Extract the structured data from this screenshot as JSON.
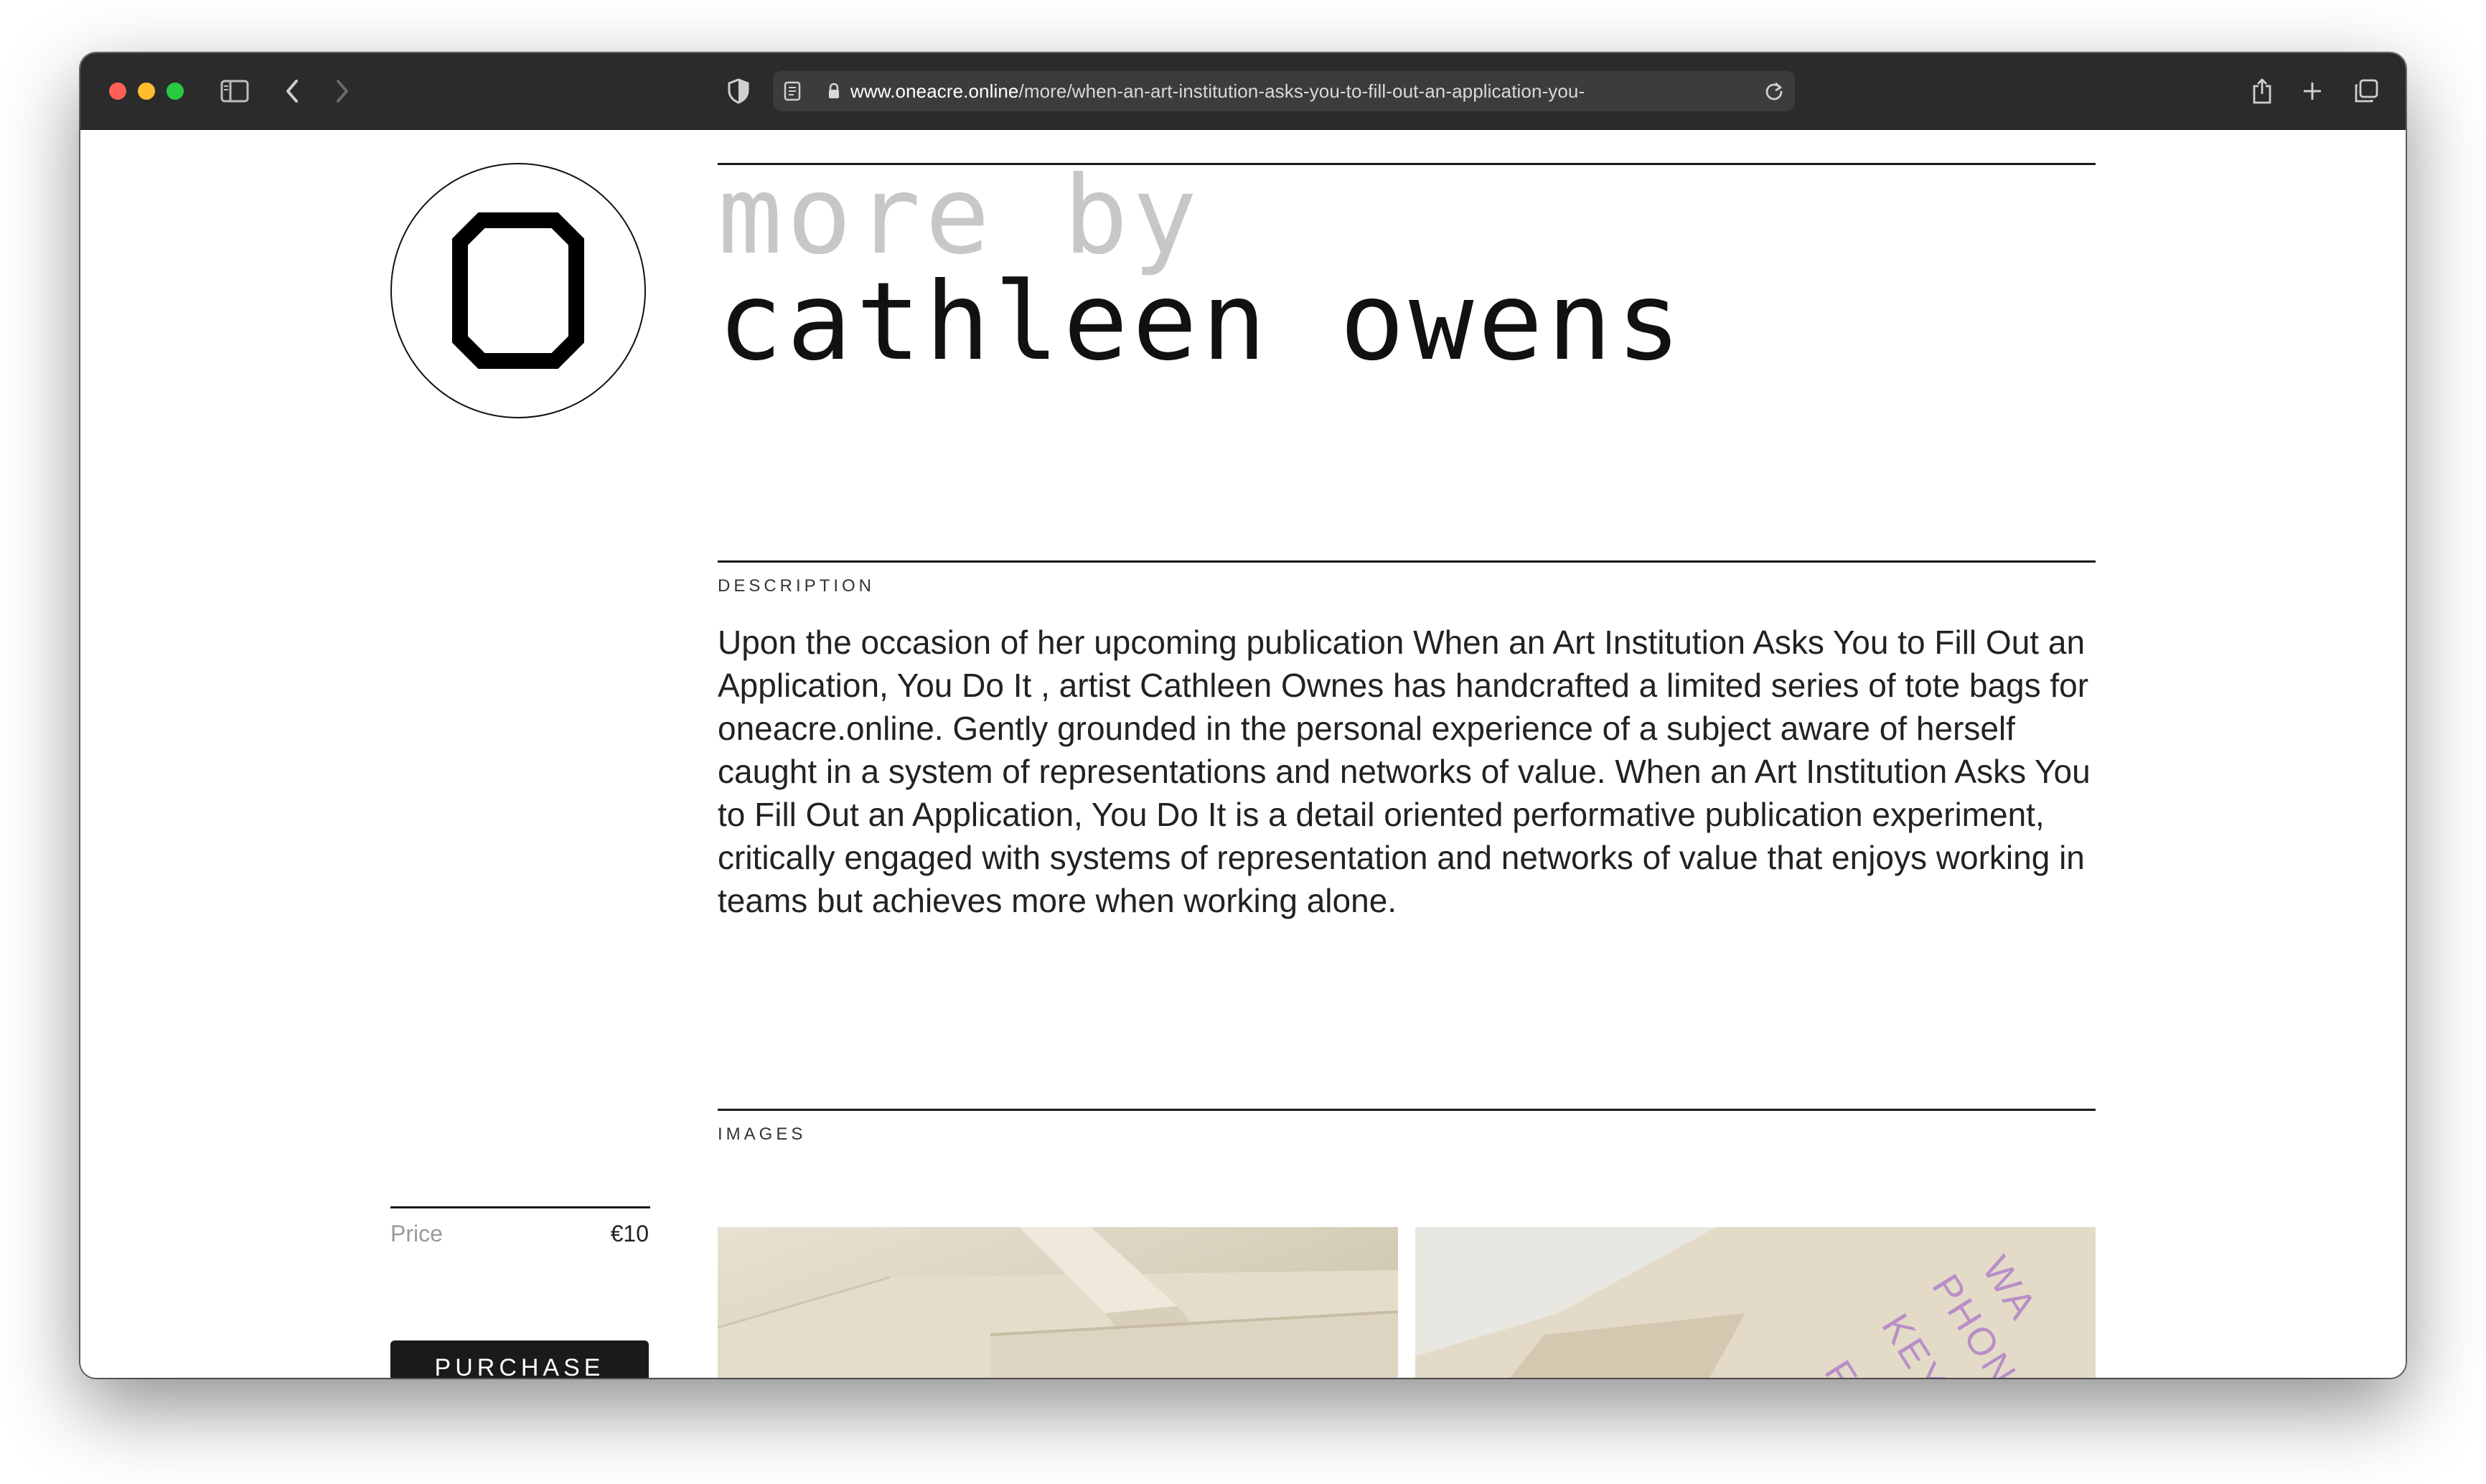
{
  "browser": {
    "url_domain": "www.oneacre.online",
    "url_path": "/more/when-an-art-institution-asks-you-to-fill-out-an-application-you-"
  },
  "header": {
    "line1": "more by",
    "line2": "cathleen owens"
  },
  "logo": {
    "letter": "O"
  },
  "description": {
    "label": "DESCRIPTION",
    "text": "Upon the occasion of her upcoming publication When an Art Institution Asks You to Fill Out an Application, You Do It , artist Cathleen Ownes has handcrafted a limited series of tote bags for oneacre.online. Gently grounded in the personal experience of a subject aware of herself caught in a system of representations and networks of value. When an Art Institution Asks You to Fill Out an Application, You Do It is a detail oriented performative publication experiment, critically engaged with systems of representation and networks of value that enjoys working in teams but achieves more when working alone."
  },
  "images": {
    "label": "IMAGES",
    "tote_print": [
      "WA",
      "PHONE",
      "KEYS",
      "FU"
    ]
  },
  "purchase": {
    "price_label": "Price",
    "price_value": "€10",
    "button_label": "PURCHASE"
  },
  "colors": {
    "toolbar": "#2b2b2b",
    "button": "#1a1a1a",
    "print_pink": "#b98ec6"
  }
}
